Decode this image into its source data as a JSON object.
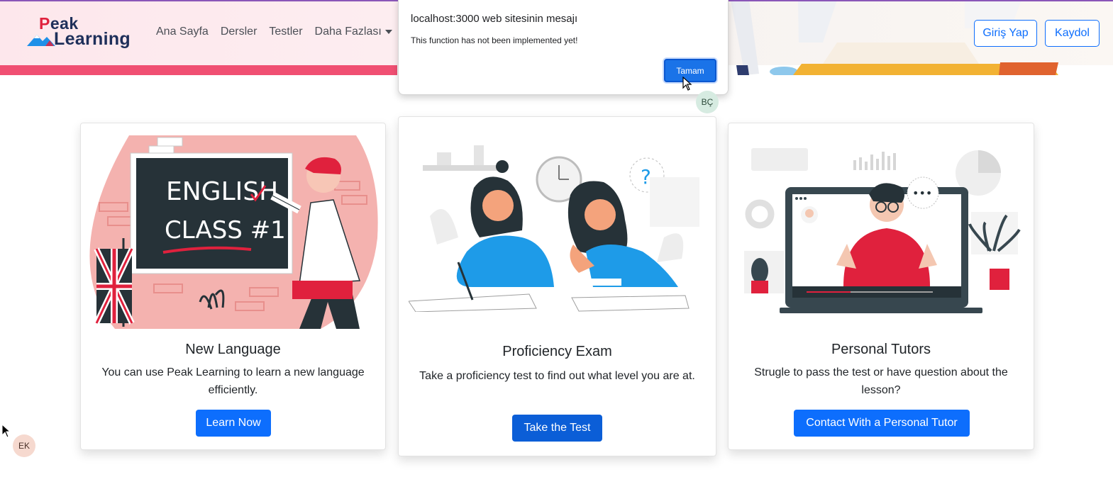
{
  "header": {
    "logo_peak_first": "P",
    "logo_peak_rest": "eak",
    "logo_learning": "Learning",
    "nav": [
      "Ana Sayfa",
      "Dersler",
      "Testler",
      "Daha Fazlası"
    ],
    "login_label": "Giriş Yap",
    "signup_label": "Kaydol",
    "colors": {
      "stripe": "#f04f72",
      "primary": "#0d6efd",
      "logo_red": "#e0213d",
      "logo_navy": "#1e2f5a"
    }
  },
  "cards": [
    {
      "title": "New Language",
      "text": "You can use Peak Learning to learn a new language efficiently.",
      "button": "Learn Now",
      "illustration_lines": [
        "ENGLISH",
        "CLASS #1"
      ]
    },
    {
      "title": "Proficiency Exam",
      "text": "Take a proficiency test to find out what level you are at.",
      "button": "Take the Test",
      "illustration_lines": [
        "?"
      ]
    },
    {
      "title": "Personal Tutors",
      "text": "Strugle to pass the test or have question about the lesson?",
      "button": "Contact With a Personal Tutor",
      "illustration_lines": [
        "•••"
      ]
    }
  ],
  "alert": {
    "title": "localhost:3000 web sitesinin mesajı",
    "message": "This function has not been implemented yet!",
    "ok_label": "Tamam"
  },
  "avatars": {
    "top": "BÇ",
    "bottom": "EK"
  }
}
